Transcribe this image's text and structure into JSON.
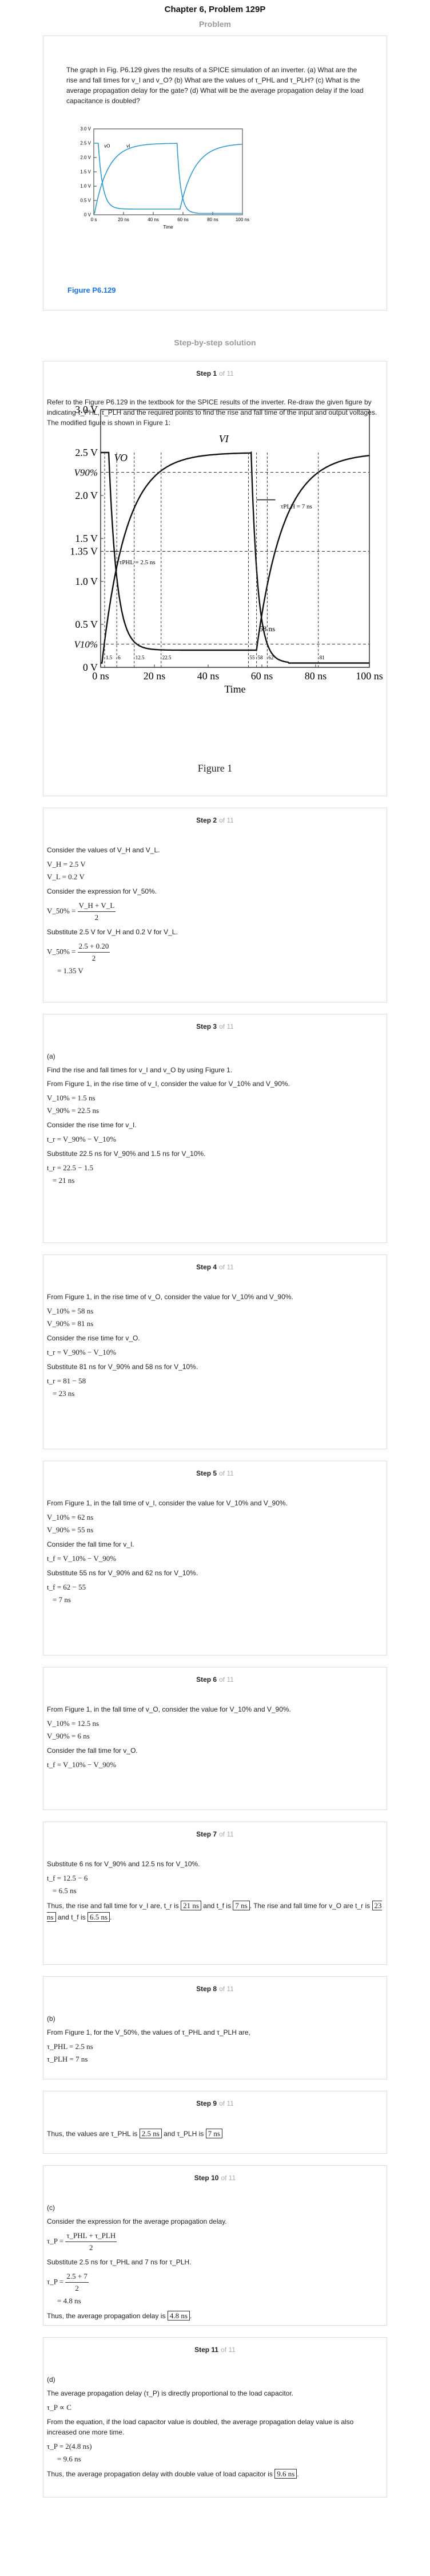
{
  "header": {
    "title": "Chapter 6, Problem 129P",
    "problem_label": "Problem"
  },
  "problem": {
    "text": "The graph in Fig. P6.129 gives the results of a SPICE simulation of an inverter. (a) What are the rise and fall times for v_I and v_O? (b) What are the values of τ_PHL and τ_PLH? (c) What is the average propagation delay for the gate? (d) What will be the average propagation delay if the load capacitance is doubled?",
    "figure_label": "Figure P6.129",
    "small_chart": {
      "y_ticks": [
        "3.0 V",
        "2.5 V",
        "2.0 V",
        "1.5 V",
        "1.0 V",
        "0.5 V",
        "0 V"
      ],
      "x_ticks": [
        "0 s",
        "20 ns",
        "40 ns",
        "60 ns",
        "80 ns",
        "100 ns"
      ],
      "xlabel": "Time",
      "vo_label": "vO",
      "vi_label": "vI"
    }
  },
  "solution_label": "Step-by-step solution",
  "steps": [
    {
      "n": "1",
      "of": "of 11"
    },
    {
      "n": "2",
      "of": "of 11"
    },
    {
      "n": "3",
      "of": "of 11"
    },
    {
      "n": "4",
      "of": "of 11"
    },
    {
      "n": "5",
      "of": "of 11"
    },
    {
      "n": "6",
      "of": "of 11"
    },
    {
      "n": "7",
      "of": "of 11"
    },
    {
      "n": "8",
      "of": "of 11"
    },
    {
      "n": "9",
      "of": "of 11"
    },
    {
      "n": "10",
      "of": "of 11"
    },
    {
      "n": "11",
      "of": "of 11"
    }
  ],
  "step1": {
    "intro": "Refer to the Figure P6.129 in the textbook for the SPICE results of the inverter. Re-draw the given figure by indicating τ_PHL, τ_PLH and the required points to find the rise and fall time of the input and output voltages. The modified figure is shown in Figure 1:",
    "figure_caption": "Figure 1",
    "chart": {
      "y_ticks": [
        "3.0 V",
        "2.5 V",
        "2.0 V",
        "1.5 V",
        "1.35 V",
        "1.0 V",
        "0.5 V",
        "0 V"
      ],
      "v90": "V90%",
      "v10": "V10%",
      "x_ticks": [
        "0 ns",
        "20 ns",
        "40 ns",
        "60 ns",
        "80 ns",
        "100 ns"
      ],
      "xlabel": "Time",
      "vo_label": "VO",
      "vi_label": "VI",
      "tphl_label": "τPHL = 2.5 ns",
      "tplh_label": "τPLH = 7 ns",
      "mark_58": "58 ns",
      "small_marks": [
        "1.5",
        "6",
        "12.5",
        "22.5",
        "55",
        "58",
        "62",
        "81"
      ]
    }
  },
  "step2": {
    "p1": "Consider the values of V_H and V_L.",
    "vh": "V_H = 2.5 V",
    "vl": "V_L = 0.2 V",
    "p2": "Consider the expression for V_50%.",
    "expr_lhs": "V_50% =",
    "expr_num": "V_H + V_L",
    "expr_den": "2",
    "p3": "Substitute 2.5 V for V_H and 0.2 V for V_L.",
    "sub_lhs": "V_50% =",
    "sub_num": "2.5 + 0.20",
    "sub_den": "2",
    "result": "= 1.35 V"
  },
  "step3": {
    "label": "(a)",
    "p1": "Find the rise and fall times for v_I and v_O by using Figure 1.",
    "p2": "From Figure 1, in the rise time of v_I, consider the value for V_10% and V_90%.",
    "v10": "V_10% = 1.5 ns",
    "v90": "V_90% = 22.5 ns",
    "p3": "Consider the rise time for v_I.",
    "expr": "t_r = V_90% − V_10%",
    "p4": "Substitute 22.5 ns for V_90% and 1.5 ns for V_10%.",
    "sub": "t_r = 22.5 − 1.5",
    "result": "= 21 ns"
  },
  "step4": {
    "p1": "From Figure 1, in the rise time of v_O, consider the value for V_10% and V_90%.",
    "v10": "V_10% = 58 ns",
    "v90": "V_90% = 81 ns",
    "p2": "Consider the rise time for v_O.",
    "expr": "t_r = V_90% − V_10%",
    "p3": "Substitute 81 ns for V_90% and 58 ns for V_10%.",
    "sub": "t_r = 81 − 58",
    "result": "= 23 ns"
  },
  "step5": {
    "p1": "From Figure 1, in the fall time of v_I, consider the value for V_10% and V_90%.",
    "v10": "V_10% = 62 ns",
    "v90": "V_90% = 55 ns",
    "p2": "Consider the fall time for v_I.",
    "expr": "t_f = V_10% − V_90%",
    "p3": "Substitute 55 ns for V_90% and 62 ns for V_10%.",
    "sub": "t_f = 62 − 55",
    "result": "= 7 ns"
  },
  "step6": {
    "p1": "From Figure 1, in the fall time of v_O, consider the value for V_10% and V_90%.",
    "v10": "V_10% = 12.5 ns",
    "v90": "V_90% = 6 ns",
    "p2": "Consider the fall time for v_O.",
    "expr": "t_f = V_10% − V_90%"
  },
  "step7": {
    "p1": "Substitute 6 ns for V_90% and 12.5 ns for V_10%.",
    "sub": "t_f = 12.5 − 6",
    "result": "= 6.5 ns",
    "c1": "Thus, the rise and fall time for v_I are, t_r is",
    "b1": "21 ns",
    "c2": "and t_f is",
    "b2": "7 ns",
    "c3": ". The rise and fall time for v_O are t_r is",
    "b3": "23 ns",
    "c4": "and t_f is",
    "b4": "6.5 ns",
    "c5": "."
  },
  "step8": {
    "label": "(b)",
    "p1": "From Figure 1, for the V_50%, the values of τ_PHL and τ_PLH are,",
    "phl": "τ_PHL = 2.5 ns",
    "plh": "τ_PLH = 7 ns"
  },
  "step9": {
    "c1": "Thus, the values are τ_PHL is",
    "b1": "2.5 ns",
    "c2": "and τ_PLH is",
    "b2": "7 ns"
  },
  "step10": {
    "label": "(c)",
    "p1": "Consider the expression for the average propagation delay.",
    "lhs": "τ_P =",
    "num": "τ_PHL + τ_PLH",
    "den": "2",
    "p2": "Substitute 2.5 ns for τ_PHL and 7 ns for τ_PLH.",
    "sub_lhs": "τ_P =",
    "sub_num": "2.5 + 7",
    "sub_den": "2",
    "result": "= 4.8 ns",
    "c1": "Thus, the average propagation delay is",
    "b1": "4.8 ns",
    "c2": "."
  },
  "step11": {
    "label": "(d)",
    "p1": "The average propagation delay (τ_P) is directly proportional to the load capacitor.",
    "prop": "τ_P ∝ C",
    "p2": "From the equation, if the load capacitor value is doubled, the average propagation delay value is also increased one more time.",
    "eq": "τ_P = 2(4.8 ns)",
    "result": "= 9.6 ns",
    "c1": "Thus, the average propagation delay with double value of load capacitor is",
    "b1": "9.6 ns",
    "c2": "."
  }
}
